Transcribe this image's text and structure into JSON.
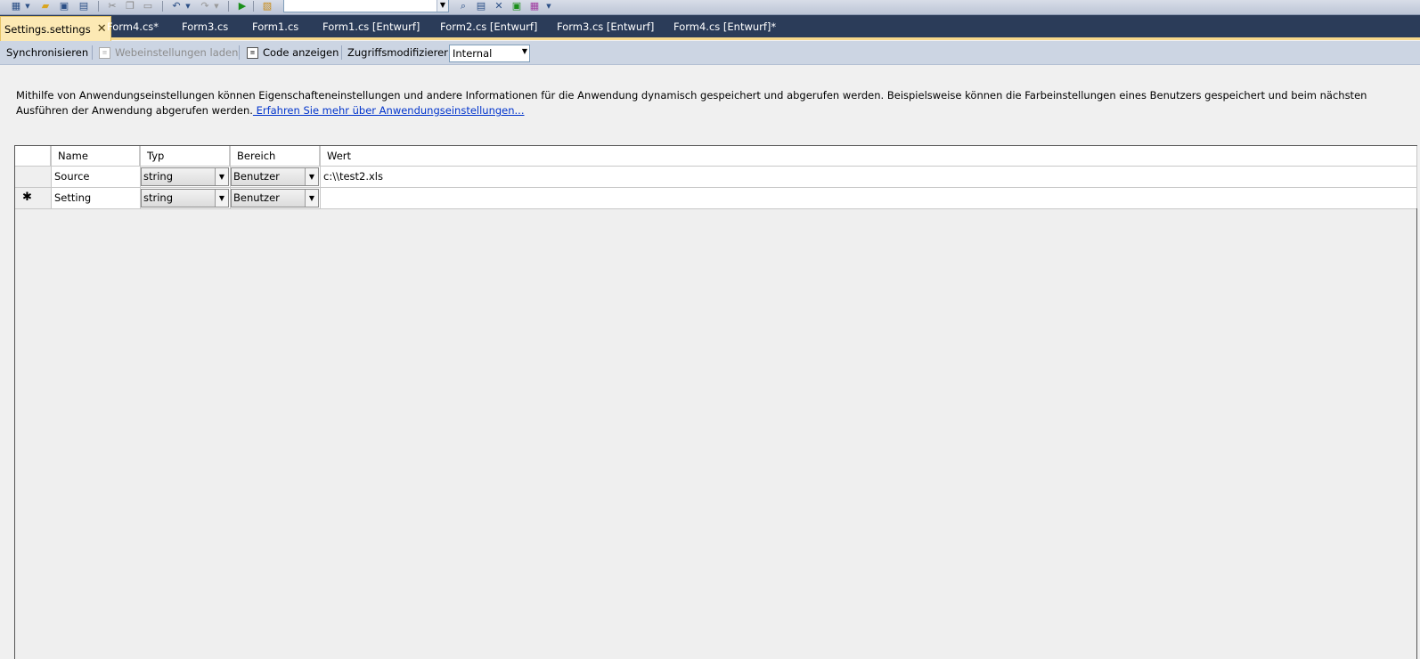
{
  "toolbar": {
    "icons": [
      "new-item-icon",
      "open-icon",
      "save-icon",
      "save-all-icon",
      "cut-icon",
      "copy-icon",
      "paste-icon",
      "undo-icon",
      "redo-icon",
      "start-debug-icon",
      "find-icon",
      "solution-explorer-icon",
      "properties-icon",
      "toolbox-icon",
      "object-browser-icon"
    ]
  },
  "tabs": [
    {
      "label": "Settings.settings",
      "active": true
    },
    {
      "label": "Form4.cs*"
    },
    {
      "label": "Form3.cs"
    },
    {
      "label": "Form1.cs"
    },
    {
      "label": "Form1.cs [Entwurf]"
    },
    {
      "label": "Form2.cs [Entwurf]"
    },
    {
      "label": "Form3.cs [Entwurf]"
    },
    {
      "label": "Form4.cs [Entwurf]*"
    }
  ],
  "designer": {
    "sync_label": "Synchronisieren",
    "web_settings_label": "Webeinstellungen laden",
    "view_code_label": "Code anzeigen",
    "access_modifier_label": "Zugriffsmodifizierer:",
    "access_modifier_value": "Internal"
  },
  "description": {
    "text": "Mithilfe von Anwendungseinstellungen können Eigenschafteneinstellungen und andere Informationen für die Anwendung dynamisch gespeichert und abgerufen werden. Beispielsweise können die Farbeinstellungen eines Benutzers gespeichert und beim nächsten Ausführen der Anwendung abgerufen werden.",
    "link": " Erfahren Sie mehr über Anwendungseinstellungen..."
  },
  "grid": {
    "columns": [
      "Name",
      "Typ",
      "Bereich",
      "Wert"
    ],
    "rows": [
      {
        "name": "Source",
        "type": "string",
        "scope": "Benutzer",
        "value": "c:\\\\test2.xls",
        "new": false
      },
      {
        "name": "Setting",
        "type": "string",
        "scope": "Benutzer",
        "value": "",
        "new": true
      }
    ],
    "new_row_marker": "✱"
  }
}
